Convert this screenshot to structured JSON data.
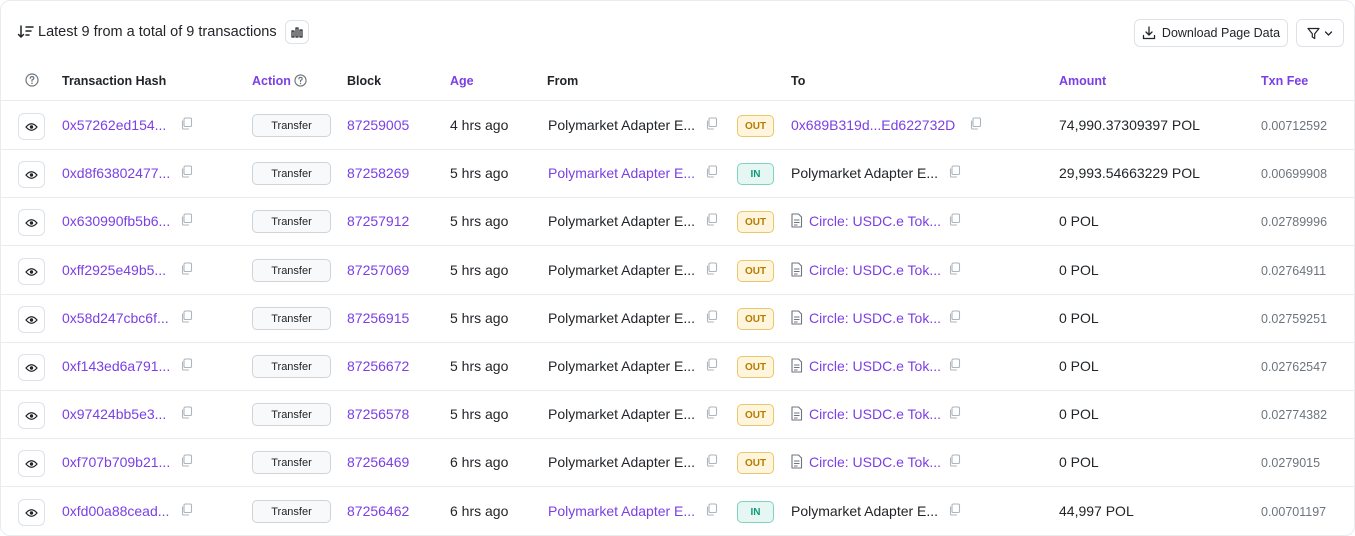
{
  "header": {
    "summary": "Latest 9 from a total of 9 transactions",
    "download_label": "Download Page Data"
  },
  "columns": {
    "hash": "Transaction Hash",
    "action": "Action",
    "block": "Block",
    "age": "Age",
    "from": "From",
    "to": "To",
    "amount": "Amount",
    "fee": "Txn Fee"
  },
  "colors": {
    "accent": "#7b3fe4",
    "out_badge": "#b47d00",
    "in_badge": "#0e9a7a"
  },
  "rows": [
    {
      "hash": "0x57262ed154...",
      "action": "Transfer",
      "block": "87259005",
      "age": "4 hrs ago",
      "from": "Polymarket Adapter E...",
      "from_link": false,
      "dir": "OUT",
      "to": "0x689B319d...Ed622732D",
      "to_link": true,
      "to_contract": false,
      "amount": "74,990.37309397 POL",
      "fee": "0.00712592"
    },
    {
      "hash": "0xd8f63802477...",
      "action": "Transfer",
      "block": "87258269",
      "age": "5 hrs ago",
      "from": "Polymarket Adapter E...",
      "from_link": true,
      "dir": "IN",
      "to": "Polymarket Adapter E...",
      "to_link": false,
      "to_contract": false,
      "amount": "29,993.54663229 POL",
      "fee": "0.00699908"
    },
    {
      "hash": "0x630990fb5b6...",
      "action": "Transfer",
      "block": "87257912",
      "age": "5 hrs ago",
      "from": "Polymarket Adapter E...",
      "from_link": false,
      "dir": "OUT",
      "to": "Circle: USDC.e Tok...",
      "to_link": true,
      "to_contract": true,
      "amount": "0 POL",
      "fee": "0.02789996"
    },
    {
      "hash": "0xff2925e49b5...",
      "action": "Transfer",
      "block": "87257069",
      "age": "5 hrs ago",
      "from": "Polymarket Adapter E...",
      "from_link": false,
      "dir": "OUT",
      "to": "Circle: USDC.e Tok...",
      "to_link": true,
      "to_contract": true,
      "amount": "0 POL",
      "fee": "0.02764911"
    },
    {
      "hash": "0x58d247cbc6f...",
      "action": "Transfer",
      "block": "87256915",
      "age": "5 hrs ago",
      "from": "Polymarket Adapter E...",
      "from_link": false,
      "dir": "OUT",
      "to": "Circle: USDC.e Tok...",
      "to_link": true,
      "to_contract": true,
      "amount": "0 POL",
      "fee": "0.02759251"
    },
    {
      "hash": "0xf143ed6a791...",
      "action": "Transfer",
      "block": "87256672",
      "age": "5 hrs ago",
      "from": "Polymarket Adapter E...",
      "from_link": false,
      "dir": "OUT",
      "to": "Circle: USDC.e Tok...",
      "to_link": true,
      "to_contract": true,
      "amount": "0 POL",
      "fee": "0.02762547"
    },
    {
      "hash": "0x97424bb5e3...",
      "action": "Transfer",
      "block": "87256578",
      "age": "5 hrs ago",
      "from": "Polymarket Adapter E...",
      "from_link": false,
      "dir": "OUT",
      "to": "Circle: USDC.e Tok...",
      "to_link": true,
      "to_contract": true,
      "amount": "0 POL",
      "fee": "0.02774382"
    },
    {
      "hash": "0xf707b709b21...",
      "action": "Transfer",
      "block": "87256469",
      "age": "6 hrs ago",
      "from": "Polymarket Adapter E...",
      "from_link": false,
      "dir": "OUT",
      "to": "Circle: USDC.e Tok...",
      "to_link": true,
      "to_contract": true,
      "amount": "0 POL",
      "fee": "0.0279015"
    },
    {
      "hash": "0xfd00a88cead...",
      "action": "Transfer",
      "block": "87256462",
      "age": "6 hrs ago",
      "from": "Polymarket Adapter E...",
      "from_link": true,
      "dir": "IN",
      "to": "Polymarket Adapter E...",
      "to_link": false,
      "to_contract": false,
      "amount": "44,997 POL",
      "fee": "0.00701197"
    }
  ]
}
